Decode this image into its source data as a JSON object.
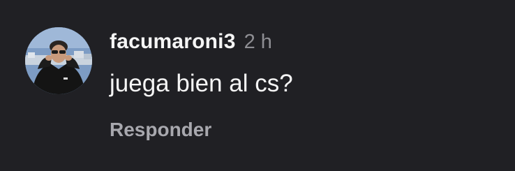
{
  "comment": {
    "username": "facumaroni3",
    "time": "2 h",
    "text": "juega bien al cs?",
    "reply_label": "Responder"
  },
  "colors": {
    "background": "#202024",
    "primary_text": "#f5f5f5",
    "secondary_text": "#8e8e93",
    "reply_text": "#a8a8ae"
  },
  "icons": {
    "avatar": "profile-photo"
  }
}
